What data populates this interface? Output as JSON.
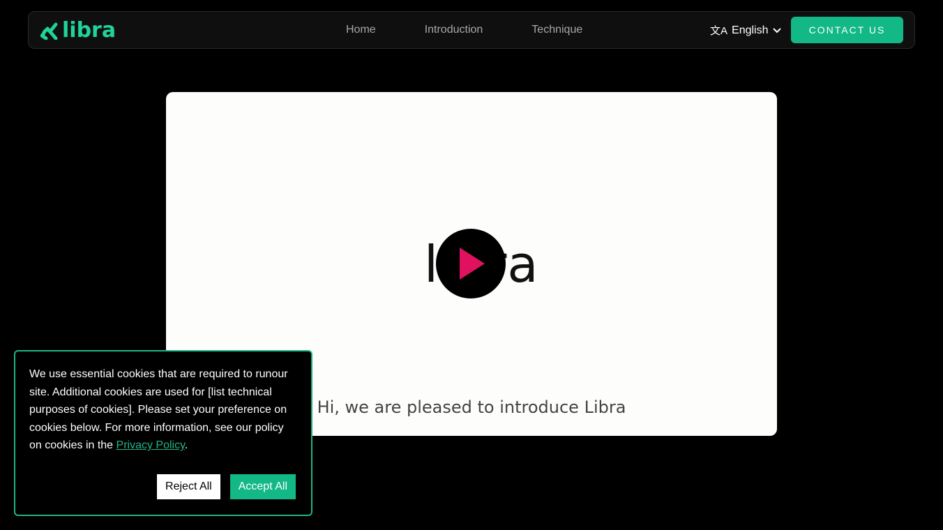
{
  "nav": {
    "brand": "libra",
    "links": [
      "Home",
      "Introduction",
      "Technique"
    ],
    "language": "English",
    "contact": "CONTACT US"
  },
  "video": {
    "logo_text": "libra",
    "caption": "Hi, we are pleased to introduce Libra"
  },
  "cookie": {
    "text": "We use essential cookies that are required to runour site. Additional cookies are used for [list technical purposes of cookies]. Please set your preference on cookies below. For more information, see our policy on cookies in the ",
    "link": "Privacy Policy",
    "end": ".",
    "reject": "Reject All",
    "accept": "Accept All"
  },
  "colors": {
    "accent": "#12b886",
    "play": "#e0115f"
  }
}
